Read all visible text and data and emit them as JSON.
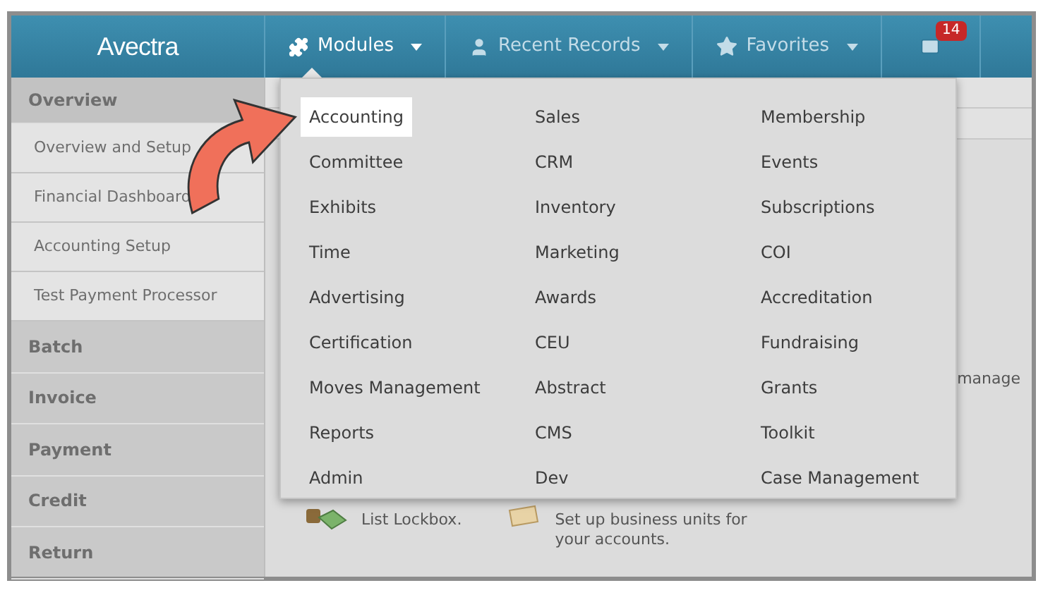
{
  "header": {
    "logo": "Avectra",
    "nav": [
      {
        "kind": "menu",
        "label": "Modules",
        "selected": true
      },
      {
        "kind": "menu",
        "label": "Recent Records",
        "selected": false
      },
      {
        "kind": "menu",
        "label": "Favorites",
        "selected": false
      },
      {
        "kind": "mail",
        "badge": "14",
        "selected": false
      }
    ]
  },
  "sidebar": {
    "sections": [
      {
        "label": "Overview",
        "expanded": true,
        "items": [
          "Overview and Setup",
          "Financial Dashboard",
          "Accounting Setup",
          "Test Payment Processor"
        ]
      },
      {
        "label": "Batch",
        "expanded": false
      },
      {
        "label": "Invoice",
        "expanded": false
      },
      {
        "label": "Payment",
        "expanded": false
      },
      {
        "label": "Credit",
        "expanded": false
      },
      {
        "label": "Return",
        "expanded": false
      }
    ]
  },
  "content": {
    "cut_text": "manage",
    "tasks": [
      {
        "text": "List Lockbox."
      },
      {
        "text": "Set up business units for your accounts."
      }
    ]
  },
  "modules_menu": {
    "items": [
      {
        "label": "Accounting",
        "selected": true
      },
      {
        "label": "Sales",
        "selected": false
      },
      {
        "label": "Membership",
        "selected": false
      },
      {
        "label": "Committee",
        "selected": false
      },
      {
        "label": "CRM",
        "selected": false
      },
      {
        "label": "Events",
        "selected": false
      },
      {
        "label": "Exhibits",
        "selected": false
      },
      {
        "label": "Inventory",
        "selected": false
      },
      {
        "label": "Subscriptions",
        "selected": false
      },
      {
        "label": "Time",
        "selected": false
      },
      {
        "label": "Marketing",
        "selected": false
      },
      {
        "label": "COI",
        "selected": false
      },
      {
        "label": "Advertising",
        "selected": false
      },
      {
        "label": "Awards",
        "selected": false
      },
      {
        "label": "Accreditation",
        "selected": false
      },
      {
        "label": "Certification",
        "selected": false
      },
      {
        "label": "CEU",
        "selected": false
      },
      {
        "label": "Fundraising",
        "selected": false
      },
      {
        "label": "Moves Management",
        "selected": false
      },
      {
        "label": "Abstract",
        "selected": false
      },
      {
        "label": "Grants",
        "selected": false
      },
      {
        "label": "Reports",
        "selected": false
      },
      {
        "label": "CMS",
        "selected": false
      },
      {
        "label": "Toolkit",
        "selected": false
      },
      {
        "label": "Admin",
        "selected": false
      },
      {
        "label": "Dev",
        "selected": false
      },
      {
        "label": "Case Management",
        "selected": false
      }
    ]
  }
}
